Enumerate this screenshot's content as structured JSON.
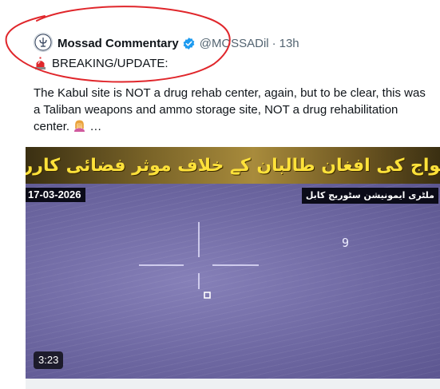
{
  "tweet": {
    "author_name": "Mossad Commentary",
    "handle": "@MOSSADil",
    "separator": "·",
    "time": "13h",
    "breaking_label": "BREAKING/UPDATE:",
    "body": "The Kabul site is NOT a drug rehab center, again, but to be clear, this was a Taliban weapons and ammo storage site, NOT a drug rehabilitation center.",
    "ellipsis": "…"
  },
  "media": {
    "banner": "پاک افواج کی افغان طالبان کے خلاف موثر فضائی کارروائیاں",
    "date": "17-03-2026",
    "caption": "ملٹری ایمونیشن سٹوریج کابل",
    "target_number": "9",
    "duration": "3:23"
  },
  "icons": {
    "avatar": "mossad-emblem-icon",
    "verified": "verified-badge-icon",
    "siren": "police-siren-icon",
    "emoji": "woman-facepalming-icon"
  },
  "colors": {
    "verified_blue": "#1d9bf0",
    "handle_gray": "#536471",
    "annotation_red": "#e0262b",
    "banner_text": "#ffe23a",
    "video_tint": "#6f6a9c"
  }
}
